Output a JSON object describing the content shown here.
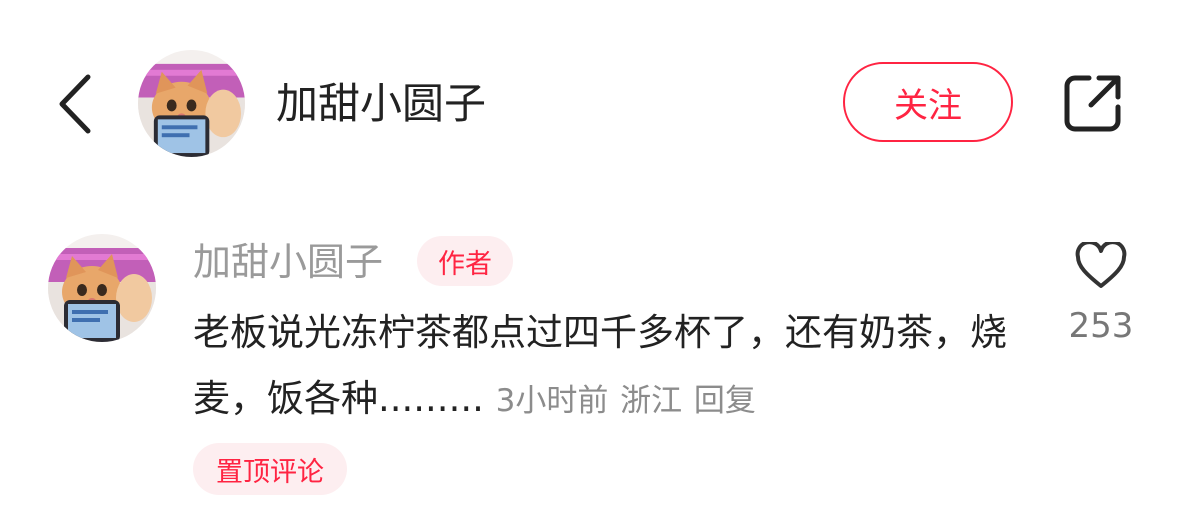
{
  "header": {
    "back_icon": "chevron-left-icon",
    "avatar_icon": "cat-avatar-icon",
    "username": "加甜小圆子",
    "follow_label": "关注",
    "share_icon": "share-external-icon"
  },
  "comment": {
    "avatar_icon": "cat-avatar-icon",
    "author": "加甜小圆子",
    "author_badge": "作者",
    "text": "老板说光冻柠茶都点过四千多杯了，还有奶茶，烧麦，饭各种.........",
    "time": "3小时前",
    "location": "浙江",
    "reply_label": "回复",
    "pinned_label": "置顶评论",
    "like_icon": "heart-outline-icon",
    "like_count": "253"
  },
  "colors": {
    "accent": "#ff2442",
    "badge_bg": "#fdeef0",
    "text_primary": "#222222",
    "text_secondary": "#9a9a9a"
  }
}
